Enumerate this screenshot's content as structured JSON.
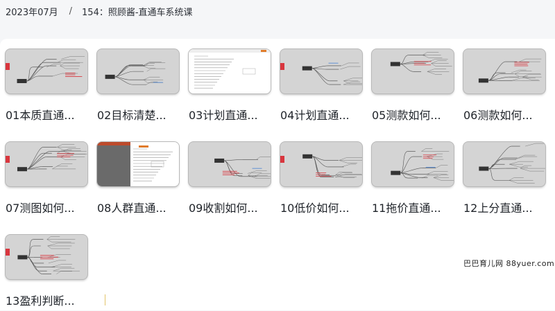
{
  "breadcrumb": {
    "folder": "2023年07月",
    "separator": "/",
    "current": "154：照顾酱-直通车系统课"
  },
  "lessons": [
    {
      "title": "01本质直通...",
      "style": "mindmap"
    },
    {
      "title": "02目标清楚...",
      "style": "mindmap"
    },
    {
      "title": "03计划直通...",
      "style": "webpage"
    },
    {
      "title": "04计划直通...",
      "style": "mindmap"
    },
    {
      "title": "05测款如何...",
      "style": "mindmap"
    },
    {
      "title": "06测款如何...",
      "style": "mindmap"
    },
    {
      "title": "07测图如何...",
      "style": "mindmap"
    },
    {
      "title": "08人群直通...",
      "style": "webpage-dark"
    },
    {
      "title": "09收割如何...",
      "style": "mindmap"
    },
    {
      "title": "10低价如何...",
      "style": "mindmap"
    },
    {
      "title": "11拖价直通...",
      "style": "mindmap"
    },
    {
      "title": "12上分直通...",
      "style": "mindmap"
    },
    {
      "title": "13盈利判断...",
      "style": "mindmap"
    }
  ],
  "watermark": "巴巴育儿网 88yuer.com",
  "colors": {
    "thumb_bg": "#d4d4d4",
    "accent_red": "#d9363e",
    "page_bg": "#f5f6f8"
  }
}
